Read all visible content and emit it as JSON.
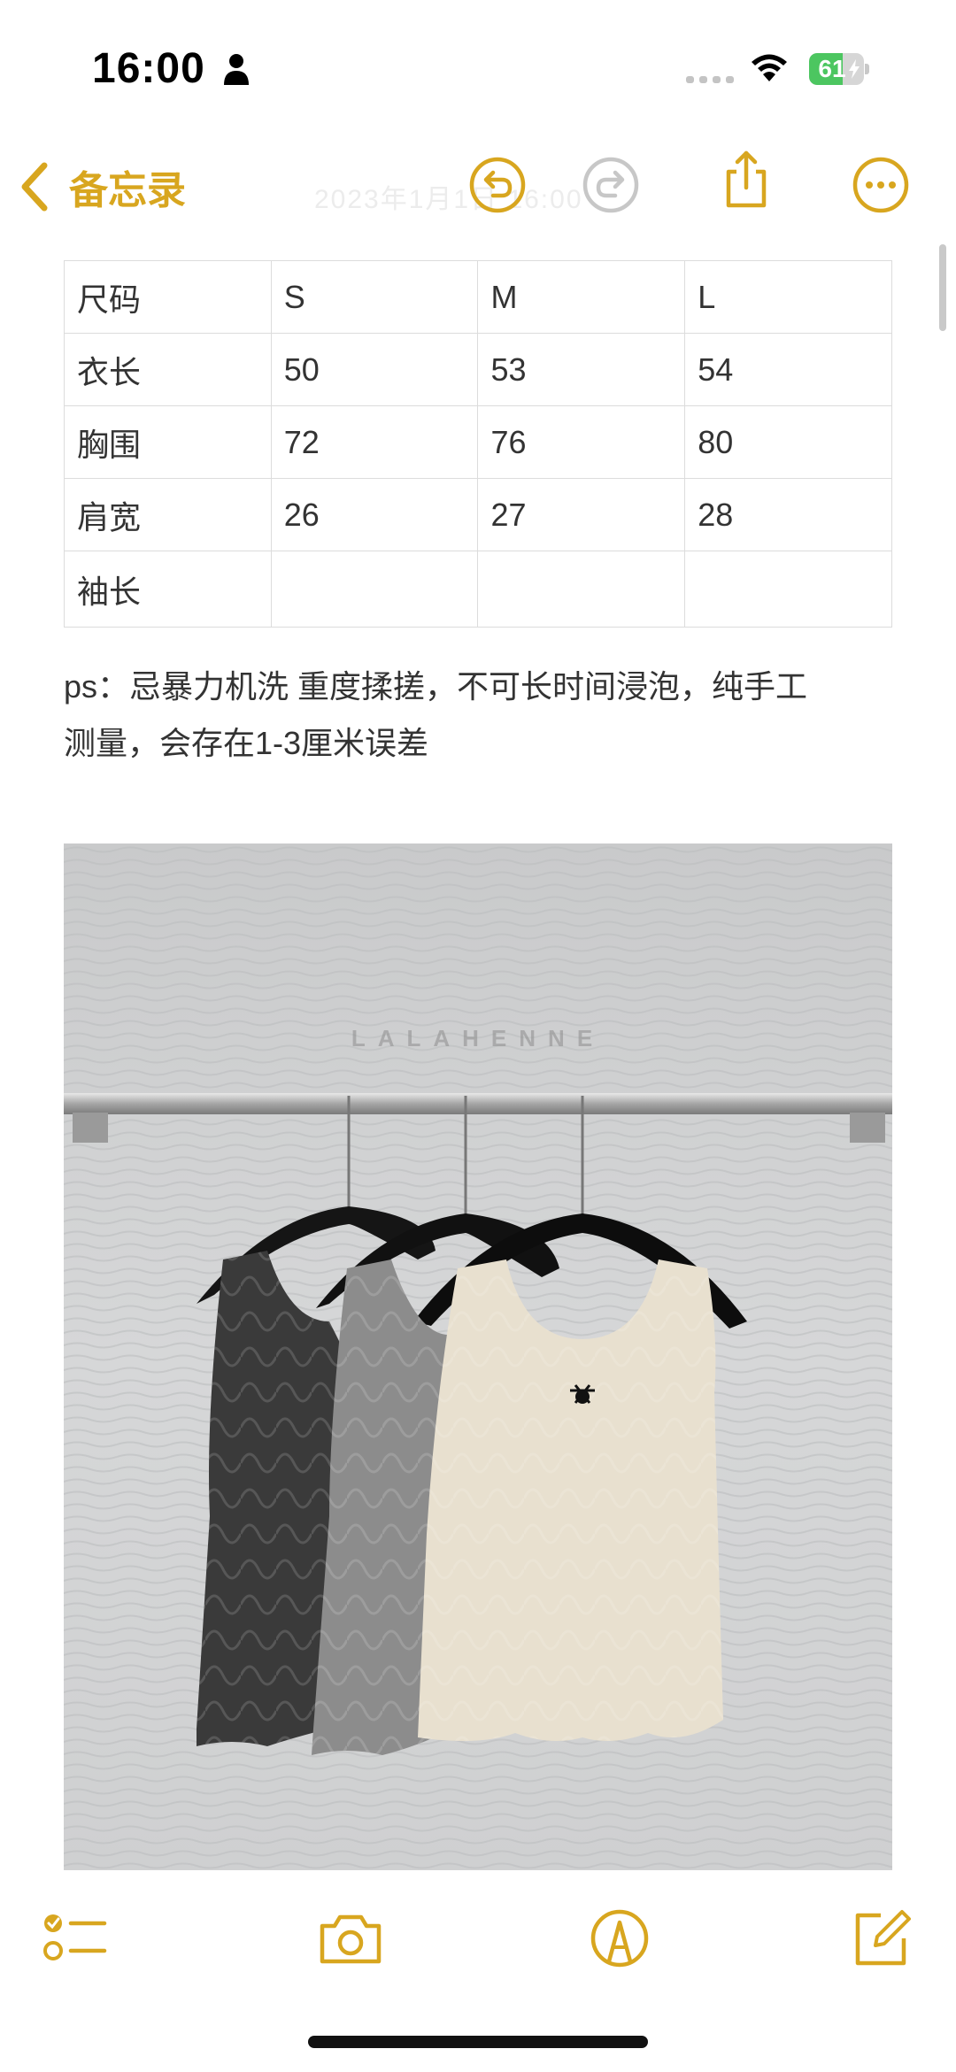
{
  "status_bar": {
    "time": "16:00",
    "battery_level": "61",
    "battery_fraction": 0.61
  },
  "nav": {
    "back_label": "备忘录",
    "faded_date": "2023年1月1日 16:00",
    "icons": [
      "undo-icon",
      "redo-icon",
      "share-icon",
      "more-icon"
    ]
  },
  "table": {
    "rows": [
      [
        "尺码",
        "S",
        "M",
        "L"
      ],
      [
        "衣长",
        "50",
        "53",
        "54"
      ],
      [
        "胸围",
        "72",
        "76",
        "80"
      ],
      [
        "肩宽",
        "26",
        "27",
        "28"
      ],
      [
        "袖长",
        "",
        "",
        ""
      ]
    ]
  },
  "note": {
    "line1": "ps：忌暴力机洗 重度揉搓，不可长时间浸泡，纯手工",
    "line2": "测量，会存在1-3厘米误差"
  },
  "photo": {
    "watermark": "LALAHENNE",
    "description_icons": [
      "hanger-icon"
    ]
  },
  "toolbar": {
    "icons": [
      "checklist-icon",
      "camera-icon",
      "markup-icon",
      "compose-icon"
    ]
  },
  "colors": {
    "accent": "#d8a61f",
    "battery_green": "#4cc660",
    "table_border": "#dcdcdc"
  }
}
